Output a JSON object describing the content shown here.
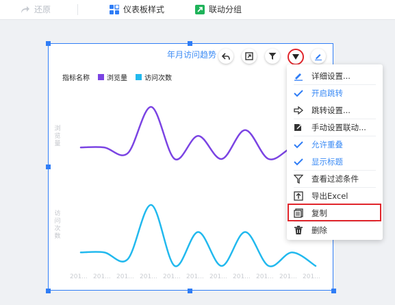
{
  "toolbar": {
    "undo_label": "还原",
    "dashboard_style_label": "仪表板样式",
    "linkage_group_label": "联动分组"
  },
  "widget": {
    "title": "年月访问趋势",
    "legend_title": "指标名称",
    "legend": [
      {
        "name": "浏览量",
        "color": "#7b44e3"
      },
      {
        "name": "访问次数",
        "color": "#22b9ee"
      }
    ],
    "y_label_top": "浏览量",
    "y_label_bottom": "访问次数",
    "x_tick_label": "201..."
  },
  "chart_data": [
    {
      "type": "line",
      "title": "",
      "ylabel": "浏览量",
      "x": [
        "201...",
        "201...",
        "201...",
        "201...",
        "201...",
        "201...",
        "201...",
        "201...",
        "201...",
        "201...",
        "201..."
      ],
      "series": [
        {
          "name": "浏览量",
          "color": "#7b44e3",
          "values": [
            2,
            2,
            1,
            9,
            0,
            4,
            0,
            5,
            0,
            2,
            3
          ]
        }
      ]
    },
    {
      "type": "line",
      "title": "",
      "ylabel": "访问次数",
      "x": [
        "201...",
        "201...",
        "201...",
        "201...",
        "201...",
        "201...",
        "201...",
        "201...",
        "201...",
        "201...",
        "201..."
      ],
      "series": [
        {
          "name": "访问次数",
          "color": "#22b9ee",
          "values": [
            2,
            2,
            1,
            9,
            0,
            5,
            0,
            5,
            0,
            2,
            0
          ]
        }
      ]
    }
  ],
  "menu": {
    "items": [
      {
        "label": "详细设置...",
        "icon": "pencil-icon",
        "style": "dark"
      },
      {
        "label": "开启跳转",
        "icon": "check-icon",
        "style": "blue"
      },
      {
        "label": "跳转设置...",
        "icon": "arrow-right-icon",
        "style": "dark"
      },
      {
        "label": "手动设置联动...",
        "icon": "link-square-icon",
        "style": "dark"
      },
      {
        "label": "允许重叠",
        "icon": "check-icon",
        "style": "blue"
      },
      {
        "label": "显示标题",
        "icon": "check-icon",
        "style": "blue"
      },
      {
        "label": "查看过滤条件",
        "icon": "filter-icon",
        "style": "dark"
      },
      {
        "label": "导出Excel",
        "icon": "export-icon",
        "style": "dark"
      },
      {
        "label": "复制",
        "icon": "copy-icon",
        "style": "dark"
      },
      {
        "label": "删除",
        "icon": "trash-icon",
        "style": "dark"
      }
    ]
  },
  "colors": {
    "accent": "#3d8cf5",
    "selection": "#2f7df6",
    "highlight": "#e0252b"
  }
}
